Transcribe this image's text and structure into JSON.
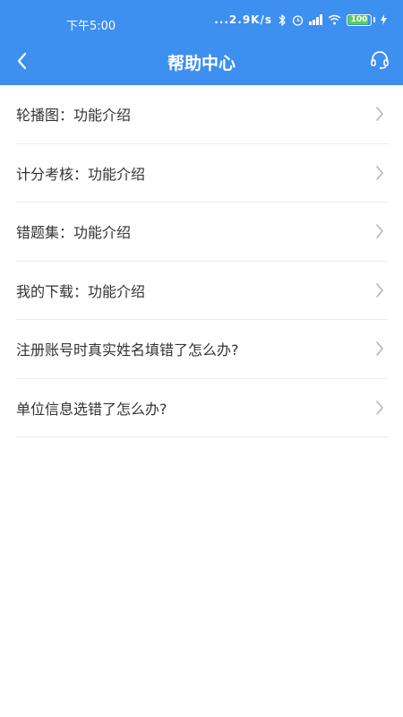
{
  "status_bar": {
    "time": "下午5:00",
    "network_speed": "...2.9K/s",
    "battery": "100"
  },
  "nav": {
    "title": "帮助中心",
    "back_icon": "chevron-left-icon",
    "support_icon": "headset-icon"
  },
  "list": {
    "items": [
      {
        "label": "轮播图：功能介绍"
      },
      {
        "label": "计分考核：功能介绍"
      },
      {
        "label": "错题集：功能介绍"
      },
      {
        "label": "我的下载：功能介绍"
      },
      {
        "label": "注册账号时真实姓名填错了怎么办?"
      },
      {
        "label": "单位信息选错了怎么办?"
      }
    ]
  },
  "colors": {
    "header": "#3d8ff0",
    "text": "#333333",
    "divider": "#ececec",
    "chevron": "#b5b5b5"
  }
}
